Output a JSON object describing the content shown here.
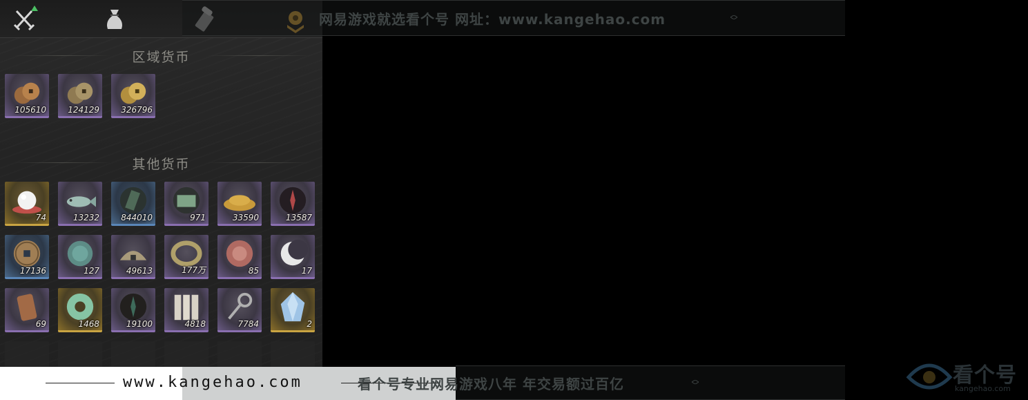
{
  "tabs": [
    {
      "id": "equipment",
      "icon": "crossed-swords-icon"
    },
    {
      "id": "materials",
      "icon": "pouch-icon"
    },
    {
      "id": "scrolls",
      "icon": "scroll-icon"
    },
    {
      "id": "currency",
      "icon": "coin-stack-icon",
      "active": true
    }
  ],
  "sections": {
    "regional": {
      "title": "区域货币"
    },
    "other": {
      "title": "其他货币"
    }
  },
  "regional_items": [
    {
      "icon": "copper-coins-icon",
      "count": "105610",
      "rarity": "purple"
    },
    {
      "icon": "bronze-coins-icon",
      "count": "124129",
      "rarity": "purple"
    },
    {
      "icon": "gold-coins-icon",
      "count": "326796",
      "rarity": "purple"
    }
  ],
  "other_items": [
    {
      "icon": "pearl-icon",
      "count": "74",
      "rarity": "gold"
    },
    {
      "icon": "fish-icon",
      "count": "13232",
      "rarity": "purple"
    },
    {
      "icon": "jade-tablet-icon",
      "count": "844010",
      "rarity": "blue"
    },
    {
      "icon": "green-banknote-icon",
      "count": "971",
      "rarity": "purple"
    },
    {
      "icon": "grain-pile-icon",
      "count": "33590",
      "rarity": "purple"
    },
    {
      "icon": "red-feather-icon",
      "count": "13587",
      "rarity": "purple"
    },
    {
      "icon": "square-hole-coin-icon",
      "count": "17136",
      "rarity": "blue"
    },
    {
      "icon": "jade-coin-icon",
      "count": "127",
      "rarity": "purple"
    },
    {
      "icon": "silver-ingot-icon",
      "count": "49613",
      "rarity": "purple"
    },
    {
      "icon": "coin-string-icon",
      "count": "177万",
      "rarity": "purple"
    },
    {
      "icon": "red-medallion-icon",
      "count": "85",
      "rarity": "purple"
    },
    {
      "icon": "crescent-moon-icon",
      "count": "17",
      "rarity": "purple"
    },
    {
      "icon": "bronze-token-icon",
      "count": "69",
      "rarity": "purple"
    },
    {
      "icon": "jade-ring-icon",
      "count": "1468",
      "rarity": "gold"
    },
    {
      "icon": "dark-feather-icon",
      "count": "19100",
      "rarity": "purple"
    },
    {
      "icon": "paper-slips-icon",
      "count": "4818",
      "rarity": "purple"
    },
    {
      "icon": "key-icon",
      "count": "7784",
      "rarity": "purple"
    },
    {
      "icon": "crystal-ore-icon",
      "count": "2",
      "rarity": "gold"
    }
  ],
  "watermarks": {
    "top": "网易游戏就选看个号  网址：www.kangehao.com",
    "bottom": "看个号专业网易游戏八年  年交易额过百亿",
    "url": "www.kangehao.com",
    "logo": "看个号",
    "logo_sub": "kangehao.com"
  }
}
